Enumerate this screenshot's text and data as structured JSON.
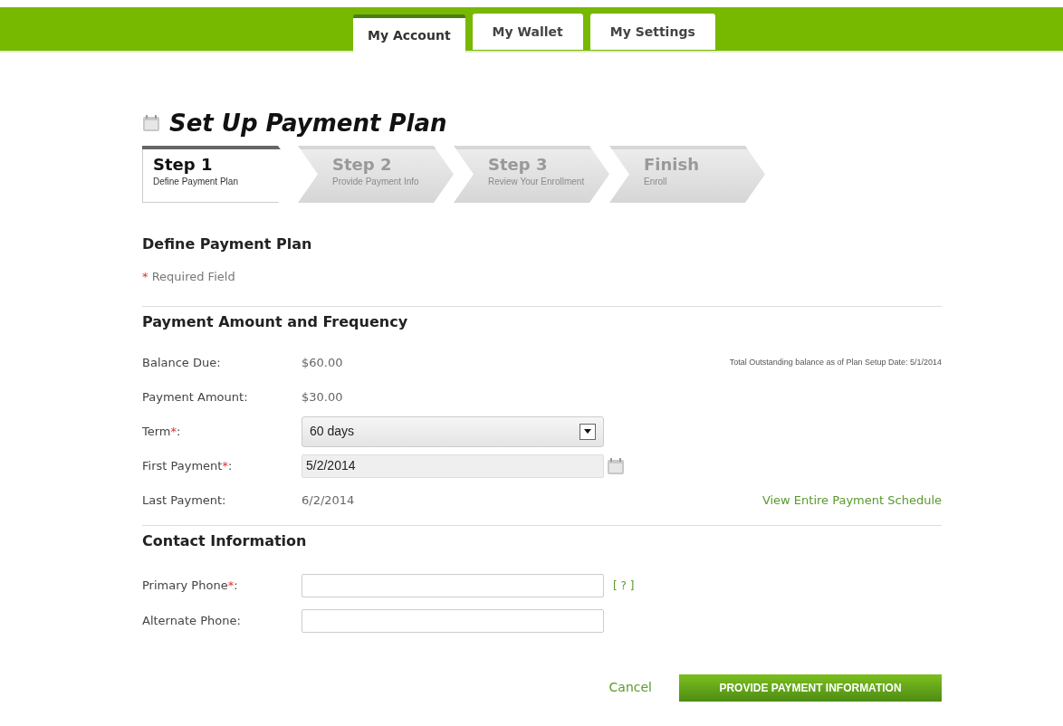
{
  "tabs": [
    {
      "label": "My Account",
      "selected": true
    },
    {
      "label": "My Wallet",
      "selected": false
    },
    {
      "label": "My Settings",
      "selected": false
    }
  ],
  "page_title": "Set Up Payment Plan",
  "steps": [
    {
      "title": "Step 1",
      "subtitle": "Define Payment Plan",
      "selected": true
    },
    {
      "title": "Step 2",
      "subtitle": "Provide Payment Info",
      "selected": false
    },
    {
      "title": "Step 3",
      "subtitle": "Review Your Enrollment",
      "selected": false
    },
    {
      "title": "Finish",
      "subtitle": "Enroll",
      "selected": false
    }
  ],
  "form_title": "Define Payment Plan",
  "required_note": {
    "marker": "*",
    "text": "Required Field"
  },
  "sections": [
    {
      "title": "Payment Amount and Frequency",
      "rows": [
        {
          "kind": "value",
          "label": "Balance Due:",
          "value": "$60.00",
          "note": "Total Outstanding balance as of Plan Setup Date: 5/1/2014"
        },
        {
          "kind": "value",
          "label": "Payment Amount:",
          "value": "$30.00"
        },
        {
          "kind": "select",
          "label": "Term",
          "required_mark": "*",
          "suffix": ":",
          "value": "60 days"
        },
        {
          "kind": "date",
          "label": "First Payment",
          "required_mark": "*",
          "suffix": ":",
          "value": "5/2/2014"
        },
        {
          "kind": "value",
          "label": "Last Payment:",
          "value": "6/2/2014",
          "link": "View Entire Payment Schedule"
        }
      ]
    },
    {
      "title": "Contact Information",
      "rows": [
        {
          "kind": "input",
          "label": "Primary Phone",
          "required_mark": "*",
          "suffix": ":",
          "help": "[ ? ]"
        },
        {
          "kind": "input",
          "label": "Alternate Phone:"
        }
      ]
    }
  ],
  "actions": {
    "cancel": "Cancel",
    "submit": "PROVIDE PAYMENT INFORMATION"
  }
}
